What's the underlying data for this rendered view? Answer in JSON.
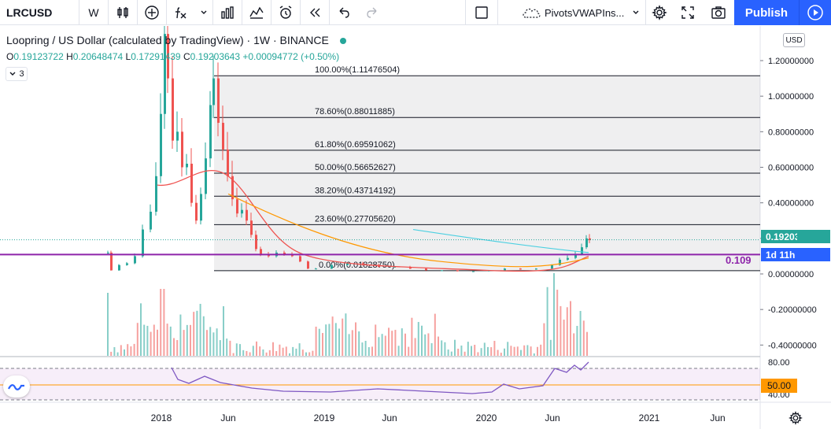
{
  "toolbar": {
    "symbol": "LRCUSD",
    "interval": "W",
    "indicator_template": "PivotsVWAPIns...",
    "publish_label": "Publish"
  },
  "legend": {
    "title": "Loopring / US Dollar (calculated by TradingView) · 1W · BINANCE",
    "open_key": "O",
    "open": "0.19123722",
    "high_key": "H",
    "high": "0.20648474",
    "low_key": "L",
    "low": "0.17291439",
    "close_key": "C",
    "close": "0.19203643",
    "change": "+0.00094772 (+0.50%)",
    "collapse_label": "3"
  },
  "price_axis": {
    "currency": "USD",
    "ticks": [
      "1.20000000",
      "1.00000000",
      "0.80000000",
      "0.60000000",
      "0.40000000",
      "0.20000000",
      "0.00000000",
      "-0.20000000",
      "-0.40000000"
    ],
    "last_price": "0.19203643",
    "countdown": "1d 11h",
    "level_label": "0.109"
  },
  "time_axis": {
    "ticks": [
      "2018",
      "Jun",
      "2019",
      "Jun",
      "2020",
      "Jun",
      "2021",
      "Jun"
    ]
  },
  "fib_levels": [
    {
      "label": "100.00%(1.11476504)",
      "value": 1.11476504
    },
    {
      "label": "78.60%(0.88011885)",
      "value": 0.88011885
    },
    {
      "label": "61.80%(0.69591062)",
      "value": 0.69591062
    },
    {
      "label": "50.00%(0.56652627)",
      "value": 0.56652627
    },
    {
      "label": "38.20%(0.43714192)",
      "value": 0.43714192
    },
    {
      "label": "23.60%(0.27705620)",
      "value": 0.2770562
    },
    {
      "label": "0.00%(0.01828750)",
      "value": 0.0182875
    }
  ],
  "rsi": {
    "ticks": [
      "80.00",
      "40.00"
    ],
    "value_tag": "50.00"
  },
  "colors": {
    "up": "#26a69a",
    "down": "#ef5350",
    "accent": "#2962ff",
    "level_line": "#8e24aa",
    "rsi_line": "#7e57c2",
    "rsi_band": "#ff9800"
  }
}
